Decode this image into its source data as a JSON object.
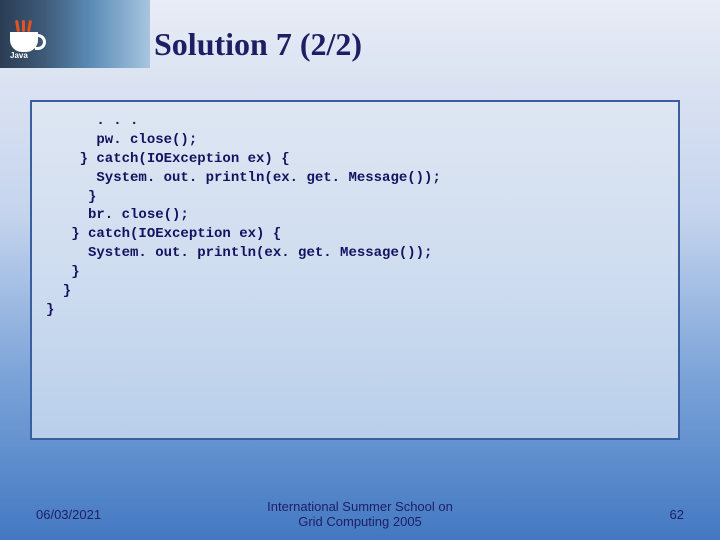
{
  "title": "Solution 7 (2/2)",
  "code": {
    "l1": "      . . .",
    "l2": "      pw. close();",
    "l3": "    } catch(IOException ex) {",
    "l4": "      System. out. println(ex. get. Message());",
    "l5": "     }",
    "l6": "     br. close();",
    "l7": "   } catch(IOException ex) {",
    "l8": "     System. out. println(ex. get. Message());",
    "l9": "   }",
    "l10": "  }",
    "l11": "}"
  },
  "footer": {
    "date": "06/03/2021",
    "center_line1": "International Summer School on",
    "center_line2": "Grid Computing 2005",
    "page": "62"
  }
}
